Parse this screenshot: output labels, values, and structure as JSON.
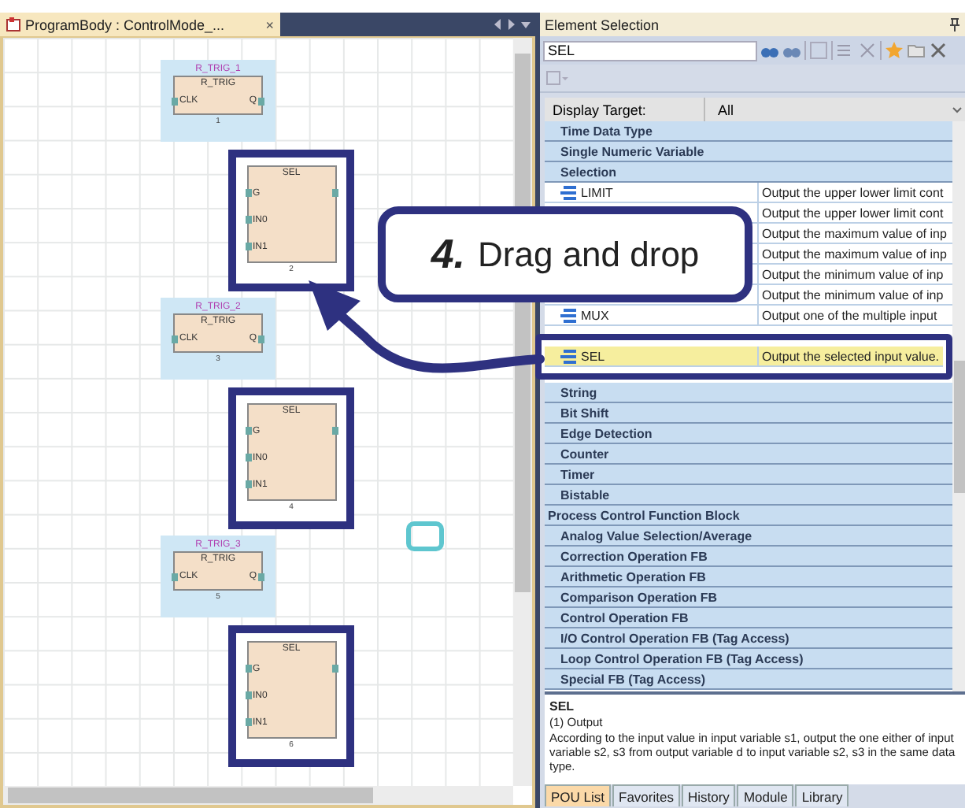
{
  "editor": {
    "tab": {
      "title": "ProgramBody : ControlMode_...",
      "close": "×"
    },
    "blocks": [
      {
        "kind": "r_trig",
        "instance": "R_TRIG_1",
        "type": "R_TRIG",
        "inputs": [
          "CLK"
        ],
        "output": "Q",
        "number": "1",
        "selected": true,
        "framed": false
      },
      {
        "kind": "sel",
        "type": "SEL",
        "inputs": [
          "G",
          "IN0",
          "IN1"
        ],
        "number": "2",
        "selected": false,
        "framed": true
      },
      {
        "kind": "r_trig",
        "instance": "R_TRIG_2",
        "type": "R_TRIG",
        "inputs": [
          "CLK"
        ],
        "output": "Q",
        "number": "3",
        "selected": true,
        "framed": false
      },
      {
        "kind": "sel",
        "type": "SEL",
        "inputs": [
          "G",
          "IN0",
          "IN1"
        ],
        "number": "4",
        "selected": false,
        "framed": true
      },
      {
        "kind": "r_trig",
        "instance": "R_TRIG_3",
        "type": "R_TRIG",
        "inputs": [
          "CLK"
        ],
        "output": "Q",
        "number": "5",
        "selected": true,
        "framed": false
      },
      {
        "kind": "sel",
        "type": "SEL",
        "inputs": [
          "G",
          "IN0",
          "IN1"
        ],
        "number": "6",
        "selected": false,
        "framed": true
      }
    ]
  },
  "element_selection": {
    "title": "Element Selection",
    "search": {
      "value": "SEL"
    },
    "display_target": {
      "label": "Display Target:",
      "value": "All"
    },
    "items": [
      {
        "kind": "group",
        "name": "Time Data Type"
      },
      {
        "kind": "group",
        "name": "Single Numeric Variable"
      },
      {
        "kind": "group",
        "name": "Selection"
      },
      {
        "kind": "function",
        "name": "LIMIT",
        "description": "Output the upper lower limit cont",
        "selected": false,
        "framed": false
      },
      {
        "kind": "function",
        "description": "Output the upper lower limit cont",
        "selected": false,
        "framed": false
      },
      {
        "kind": "function",
        "description": "Output the maximum value of inp",
        "selected": false,
        "framed": false
      },
      {
        "kind": "function",
        "description": "Output the maximum value of inp",
        "selected": false,
        "framed": false
      },
      {
        "kind": "function",
        "description": "Output the minimum value of inp",
        "selected": false,
        "framed": false
      },
      {
        "kind": "function",
        "description": "Output the minimum value of inp",
        "selected": false,
        "framed": false
      },
      {
        "kind": "function",
        "name": "MUX",
        "description": "Output one of the multiple input",
        "selected": false,
        "framed": false
      },
      {
        "kind": "function",
        "name": "SEL",
        "description": "Output the selected input value.",
        "selected": true,
        "framed": true
      },
      {
        "kind": "group",
        "name": "String"
      },
      {
        "kind": "group",
        "name": "Bit Shift"
      },
      {
        "kind": "group",
        "name": "Edge Detection"
      },
      {
        "kind": "group",
        "name": "Counter"
      },
      {
        "kind": "group",
        "name": "Timer"
      },
      {
        "kind": "group",
        "name": "Bistable"
      },
      {
        "kind": "category",
        "name": "Process Control Function Block"
      },
      {
        "kind": "group",
        "name": "Analog Value Selection/Average"
      },
      {
        "kind": "group",
        "name": "Correction Operation FB"
      },
      {
        "kind": "group",
        "name": "Arithmetic Operation FB"
      },
      {
        "kind": "group",
        "name": "Comparison Operation FB"
      },
      {
        "kind": "group",
        "name": "Control Operation FB"
      },
      {
        "kind": "group",
        "name": "I/O Control Operation FB (Tag Access)"
      },
      {
        "kind": "group",
        "name": "Loop Control Operation FB (Tag Access)"
      },
      {
        "kind": "group",
        "name": "Special FB (Tag Access)"
      }
    ],
    "description": {
      "title": "SEL",
      "heading": "(1) Output",
      "text": "According to the input value in input variable s1, output the one either of input variable s2, s3 from output variable d to input variable s2, s3 in the same data type."
    },
    "tabs": [
      {
        "label": "POU List",
        "selected": true
      },
      {
        "label": "Favorites",
        "selected": false
      },
      {
        "label": "History",
        "selected": false
      },
      {
        "label": "Module",
        "selected": false
      },
      {
        "label": "Library",
        "selected": false
      }
    ]
  },
  "callout": {
    "step": "4.",
    "text": "Drag and drop"
  }
}
